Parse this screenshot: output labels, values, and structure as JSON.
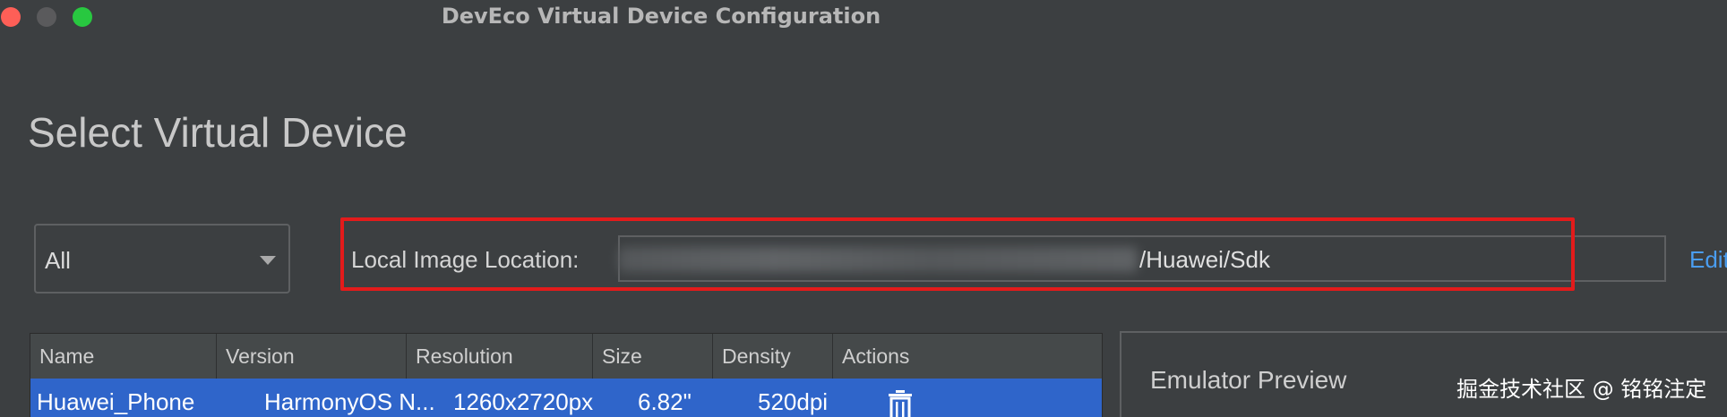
{
  "window": {
    "title": "DevEco Virtual Device Configuration"
  },
  "page": {
    "title": "Select Virtual Device"
  },
  "filter": {
    "value": "All",
    "icon": "chevron-down-icon"
  },
  "location": {
    "label": "Local Image Location:",
    "visible_suffix": "/Huawei/Sdk",
    "edit_label": "Edit",
    "highlight_color": "#e31b1b"
  },
  "table": {
    "columns": [
      "Name",
      "Version",
      "Resolution",
      "Size",
      "Density",
      "Actions"
    ],
    "rows": [
      {
        "name": "Huawei_Phone",
        "version": "HarmonyOS N...",
        "resolution": "1260x2720px",
        "size": "6.82\"",
        "density": "520dpi",
        "action_icon": "trash-icon"
      }
    ],
    "selected_row_color": "#2f65ca"
  },
  "preview": {
    "title": "Emulator Preview"
  },
  "watermark": {
    "text": "掘金技术社区 @ 铭铭注定"
  },
  "colors": {
    "background": "#3c3f41",
    "accent": "#4a9df0",
    "traffic_close": "#fe5f57",
    "traffic_minimize": "#5a5a5c",
    "traffic_maximize": "#28c840"
  }
}
